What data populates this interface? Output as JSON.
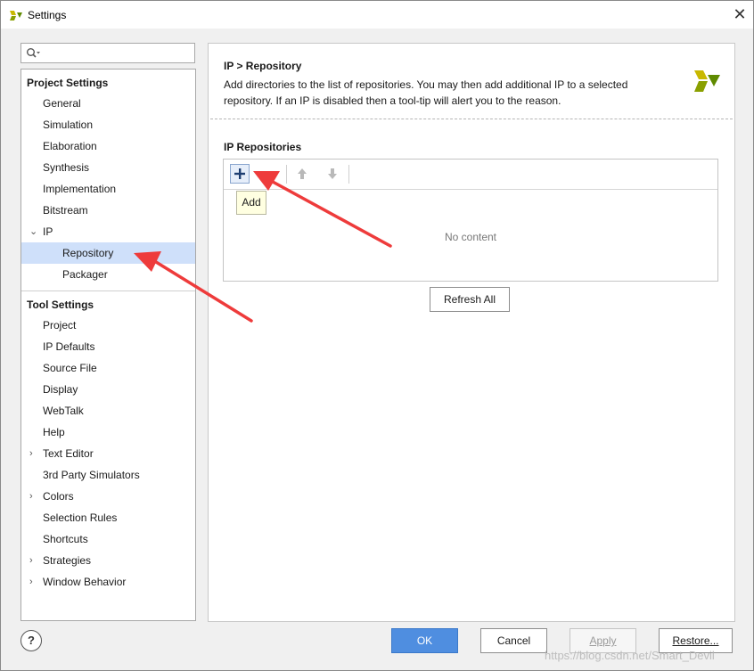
{
  "window": {
    "title": "Settings",
    "close_glyph": "✕"
  },
  "search": {
    "value": "",
    "icon": "search-icon"
  },
  "project_settings": {
    "header": "Project Settings",
    "items": [
      "General",
      "Simulation",
      "Elaboration",
      "Synthesis",
      "Implementation",
      "Bitstream",
      "IP"
    ],
    "ip_children": [
      "Repository",
      "Packager"
    ]
  },
  "tool_settings": {
    "header": "Tool Settings",
    "items": [
      "Project",
      "IP Defaults",
      "Source File",
      "Display",
      "WebTalk",
      "Help",
      "Text Editor",
      "3rd Party Simulators",
      "Colors",
      "Selection Rules",
      "Shortcuts",
      "Strategies",
      "Window Behavior"
    ]
  },
  "selected_item": "Repository",
  "content": {
    "breadcrumb": "IP > Repository",
    "description_line1": "Add directories to the list of repositories. You may then add additional IP to a selected",
    "description_line2": "repository. If an IP is disabled then a tool-tip will alert you to the reason.",
    "repos_header": "IP Repositories",
    "tooltip": "Add",
    "empty_text": "No content",
    "refresh_label": "Refresh All"
  },
  "footer": {
    "help_glyph": "?",
    "ok": "OK",
    "cancel": "Cancel",
    "apply": "Apply",
    "restore": "Restore..."
  },
  "watermark": "https://blog.csdn.net/Smart_Devil",
  "colors": {
    "accent": "#4f8ee0",
    "selection": "#cfe0fa",
    "annotation_arrow": "#ee3b3b"
  }
}
